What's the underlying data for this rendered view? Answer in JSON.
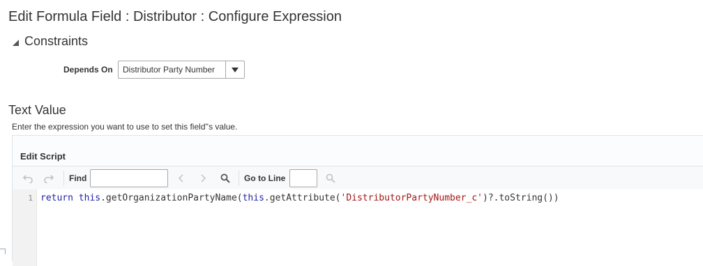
{
  "page": {
    "title": "Edit Formula Field : Distributor : Configure Expression"
  },
  "constraints": {
    "header": "Constraints",
    "depends_on_label": "Depends On",
    "depends_on_value": "Distributor Party Number"
  },
  "text_value": {
    "title": "Text Value",
    "instructions": "Enter the expression you want to use to set this field''s value."
  },
  "script": {
    "panel_title": "Edit Script",
    "toolbar": {
      "find_label": "Find",
      "find_value": "",
      "goto_label": "Go to Line",
      "goto_value": ""
    },
    "lines": [
      {
        "number": "1",
        "tokens": [
          "return",
          " ",
          "this",
          ".getOrganizationPartyName(",
          "this",
          ".getAttribute(",
          "'DistributorPartyNumber_c'",
          ")?.toString())"
        ]
      }
    ]
  },
  "icons": [
    "undo-icon",
    "redo-icon",
    "chevron-left-icon",
    "chevron-right-icon",
    "search-icon",
    "goto-search-icon",
    "collapse-triangle-icon",
    "dropdown-caret-icon"
  ]
}
